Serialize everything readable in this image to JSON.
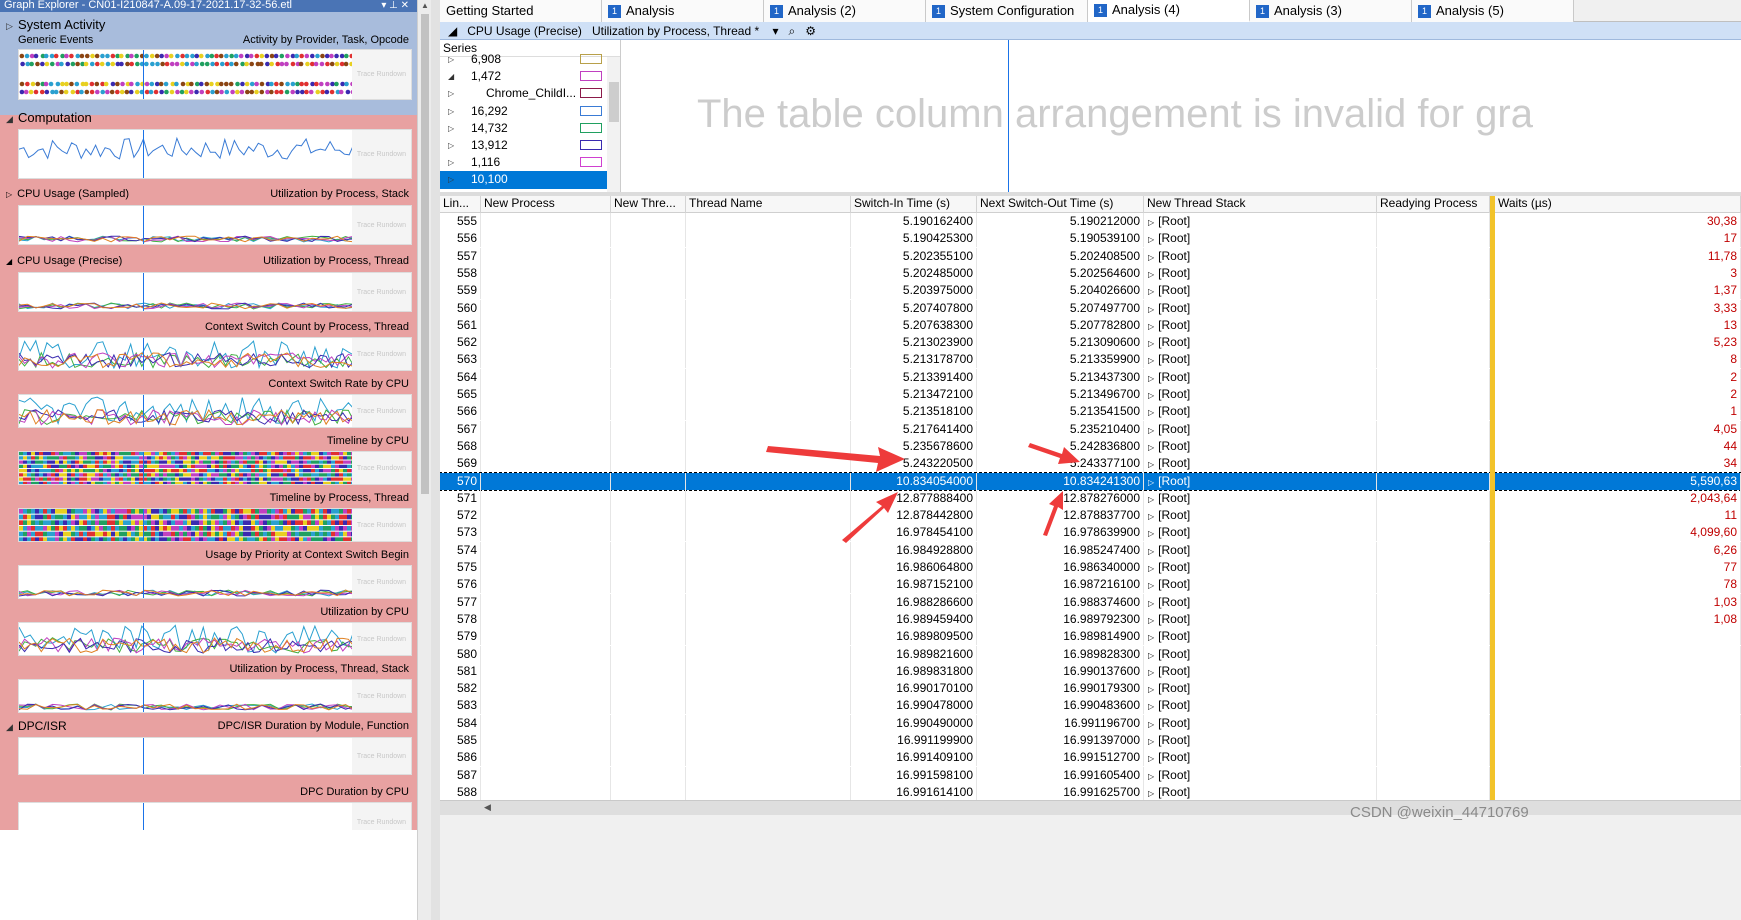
{
  "left_panel": {
    "title": "Graph Explorer - CN01-I210847-A.09-17-2021.17-32-56.etl",
    "graph_placeholder": "Trace Rundown",
    "categories": [
      {
        "label": "System Activity",
        "expanded": false
      },
      {
        "label": "Computation",
        "expanded": true
      },
      {
        "label": "DPC/ISR",
        "expanded": true
      }
    ],
    "graphs": {
      "generic_events": {
        "left": "Generic Events",
        "right": "Activity by Provider, Task, Opcode"
      },
      "cpu_sampled": {
        "left": "CPU Usage (Sampled)",
        "right": "Utilization by Process, Stack"
      },
      "cpu_precise": {
        "left": "CPU Usage (Precise)",
        "right": "Utilization by Process, Thread"
      },
      "ctx_count": {
        "right": "Context Switch Count by Process, Thread"
      },
      "ctx_rate": {
        "right": "Context Switch Rate by CPU"
      },
      "timeline_cpu": {
        "right": "Timeline by CPU"
      },
      "timeline_proc": {
        "right": "Timeline by Process, Thread"
      },
      "usage_priority": {
        "right": "Usage by Priority at Context Switch Begin"
      },
      "util_cpu": {
        "right": "Utilization by CPU"
      },
      "util_proc_stack": {
        "right": "Utilization by Process, Thread, Stack"
      },
      "dpc_duration": {
        "right": "DPC/ISR Duration by Module, Function"
      },
      "dpc_cpu": {
        "right": "DPC Duration by CPU"
      }
    }
  },
  "tabs": [
    {
      "label": "Getting Started",
      "num": "",
      "active": false
    },
    {
      "label": "Analysis",
      "num": "1",
      "active": false
    },
    {
      "label": "Analysis (2)",
      "num": "1",
      "active": false
    },
    {
      "label": "System Configuration",
      "num": "1",
      "active": false
    },
    {
      "label": "Analysis (4)",
      "num": "1",
      "active": true
    },
    {
      "label": "Analysis (3)",
      "num": "1",
      "active": false
    },
    {
      "label": "Analysis (5)",
      "num": "1",
      "active": false
    }
  ],
  "view": {
    "graph_name": "CPU Usage (Precise)",
    "preset": "Utilization by Process, Thread *",
    "invalid_msg": "The table column arrangement is invalid for gra"
  },
  "series": {
    "header": "Series",
    "rows": [
      {
        "label": "6,908",
        "color": "#b8a04a",
        "expander": "▷",
        "selected": false
      },
      {
        "label": "1,472",
        "color": "#c040c0",
        "expander": "◢",
        "selected": false
      },
      {
        "label": "Chrome_ChildI...",
        "color": "#8b1a4a",
        "expander": "▷",
        "selected": false
      },
      {
        "label": "16,292",
        "color": "#3a7bd5",
        "expander": "▷",
        "selected": false
      },
      {
        "label": "14,732",
        "color": "#20a060",
        "expander": "▷",
        "selected": false
      },
      {
        "label": "13,912",
        "color": "#3a2ab0",
        "expander": "▷",
        "selected": false
      },
      {
        "label": "1,116",
        "color": "#d040d0",
        "expander": "▷",
        "selected": false
      },
      {
        "label": "10,100",
        "color": "#0078d7",
        "expander": "▷",
        "selected": true
      }
    ]
  },
  "table": {
    "columns": [
      "Lin...",
      "New Process",
      "New Thre...",
      "Thread Name",
      "Switch-In Time (s)",
      "Next Switch-Out Time (s)",
      "New Thread Stack",
      "Readying Process",
      "Waits (µs)"
    ],
    "stack_label": "[Root]",
    "rows": [
      {
        "line": "555",
        "in": "5.190162400",
        "out": "5.190212000",
        "waits": "30,38"
      },
      {
        "line": "556",
        "in": "5.190425300",
        "out": "5.190539100",
        "waits": "17"
      },
      {
        "line": "557",
        "in": "5.202355100",
        "out": "5.202408500",
        "waits": "11,78"
      },
      {
        "line": "558",
        "in": "5.202485000",
        "out": "5.202564600",
        "waits": "3"
      },
      {
        "line": "559",
        "in": "5.203975000",
        "out": "5.204026600",
        "waits": "1,37"
      },
      {
        "line": "560",
        "in": "5.207407800",
        "out": "5.207497700",
        "waits": "3,33"
      },
      {
        "line": "561",
        "in": "5.207638300",
        "out": "5.207782800",
        "waits": "13"
      },
      {
        "line": "562",
        "in": "5.213023900",
        "out": "5.213090600",
        "waits": "5,23"
      },
      {
        "line": "563",
        "in": "5.213178700",
        "out": "5.213359900",
        "waits": "8"
      },
      {
        "line": "564",
        "in": "5.213391400",
        "out": "5.213437300",
        "waits": "2"
      },
      {
        "line": "565",
        "in": "5.213472100",
        "out": "5.213496700",
        "waits": "2"
      },
      {
        "line": "566",
        "in": "5.213518100",
        "out": "5.213541500",
        "waits": "1"
      },
      {
        "line": "567",
        "in": "5.217641400",
        "out": "5.235210400",
        "waits": "4,05"
      },
      {
        "line": "568",
        "in": "5.235678600",
        "out": "5.242836800",
        "waits": "44"
      },
      {
        "line": "569",
        "in": "5.243220500",
        "out": "5.243377100",
        "waits": "34"
      },
      {
        "line": "570",
        "in": "10.834054000",
        "out": "10.834241300",
        "waits": "5,590,63",
        "selected": true
      },
      {
        "line": "571",
        "in": "12.877888400",
        "out": "12.878276000",
        "waits": "2,043,64"
      },
      {
        "line": "572",
        "in": "12.878442800",
        "out": "12.878837700",
        "waits": "11"
      },
      {
        "line": "573",
        "in": "16.978454100",
        "out": "16.978639900",
        "waits": "4,099,60"
      },
      {
        "line": "574",
        "in": "16.984928800",
        "out": "16.985247400",
        "waits": "6,26"
      },
      {
        "line": "575",
        "in": "16.986064800",
        "out": "16.986340000",
        "waits": "77"
      },
      {
        "line": "576",
        "in": "16.987152100",
        "out": "16.987216100",
        "waits": "78"
      },
      {
        "line": "577",
        "in": "16.988286600",
        "out": "16.988374600",
        "waits": "1,03"
      },
      {
        "line": "578",
        "in": "16.989459400",
        "out": "16.989792300",
        "waits": "1,08"
      },
      {
        "line": "579",
        "in": "16.989809500",
        "out": "16.989814900",
        "waits": ""
      },
      {
        "line": "580",
        "in": "16.989821600",
        "out": "16.989828300",
        "waits": ""
      },
      {
        "line": "581",
        "in": "16.989831800",
        "out": "16.990137600",
        "waits": ""
      },
      {
        "line": "582",
        "in": "16.990170100",
        "out": "16.990179300",
        "waits": ""
      },
      {
        "line": "583",
        "in": "16.990478000",
        "out": "16.990483600",
        "waits": ""
      },
      {
        "line": "584",
        "in": "16.990490000",
        "out": "16.991196700",
        "waits": ""
      },
      {
        "line": "585",
        "in": "16.991199900",
        "out": "16.991397000",
        "waits": ""
      },
      {
        "line": "586",
        "in": "16.991409100",
        "out": "16.991512700",
        "waits": ""
      },
      {
        "line": "587",
        "in": "16.991598100",
        "out": "16.991605400",
        "waits": ""
      },
      {
        "line": "588",
        "in": "16.991614100",
        "out": "16.991625700",
        "waits": ""
      }
    ]
  },
  "watermark": "CSDN @weixin_44710769",
  "colors": {
    "selection": "#0078d7",
    "accent_line": "#f2c32a",
    "arrow": "#ee3b3b",
    "category_bg": "#e8a1a1",
    "sysact_bg": "#a8bcdc"
  }
}
